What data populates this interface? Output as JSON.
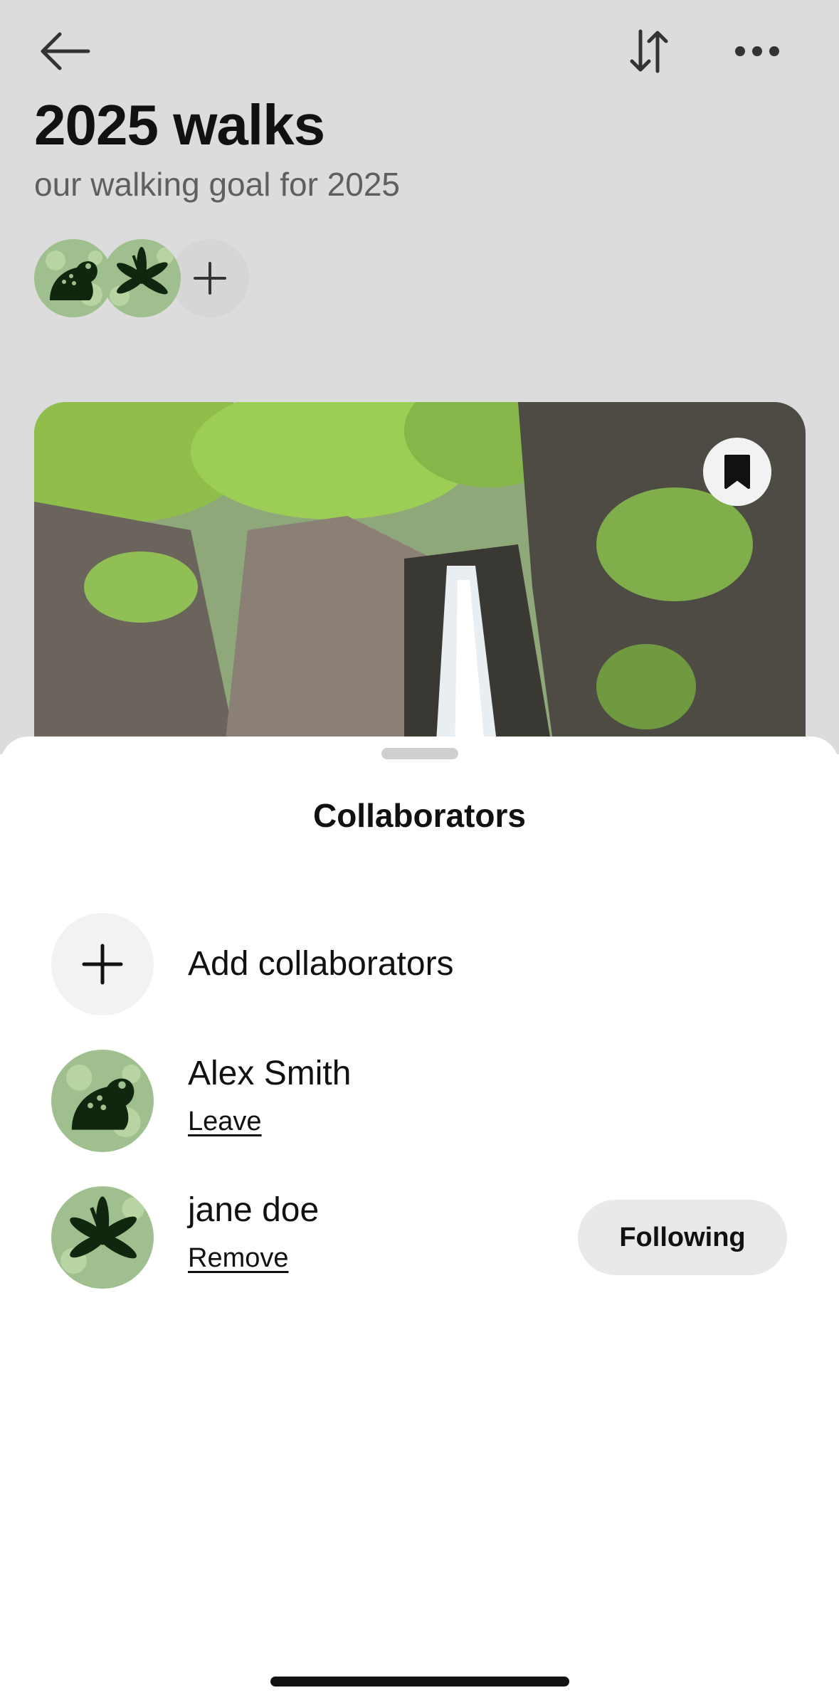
{
  "header": {
    "title": "2025 walks",
    "subtitle": "our walking goal for 2025",
    "back_icon": "arrow-left-icon",
    "sort_icon": "sort-arrows-icon",
    "more_icon": "ellipsis-icon"
  },
  "board": {
    "avatars": [
      {
        "icon": "frog-icon"
      },
      {
        "icon": "leaf-icon"
      }
    ],
    "add_icon": "plus-icon",
    "pin_save_icon": "bookmark-icon"
  },
  "sheet": {
    "title": "Collaborators",
    "add_label": "Add collaborators",
    "collaborators": [
      {
        "name": "Alex Smith",
        "action": "Leave",
        "avatar_icon": "frog-icon"
      },
      {
        "name": "jane doe",
        "action": "Remove",
        "avatar_icon": "leaf-icon",
        "follow_label": "Following"
      }
    ]
  },
  "colors": {
    "backdrop": "#dcdcdc",
    "avatar_green": "#9fbf8e",
    "icon_dark": "#10260e",
    "button_gray": "#e9e9e9"
  }
}
